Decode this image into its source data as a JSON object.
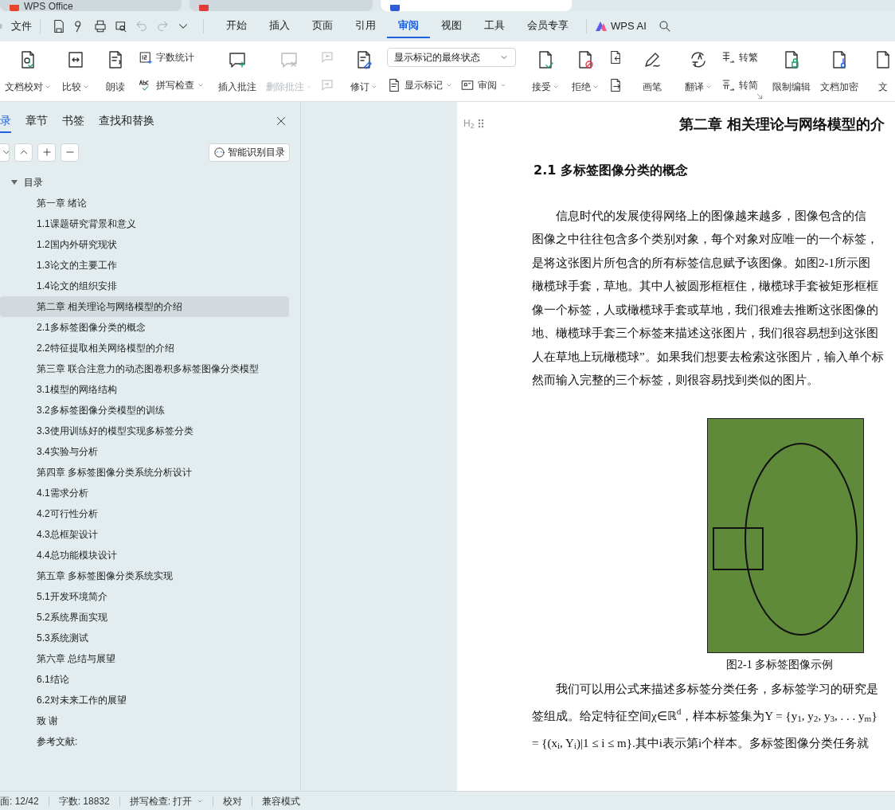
{
  "browser_tabs": [
    {
      "label": "WPS Office",
      "selected": false
    },
    {
      "selected": false
    },
    {
      "selected": true
    }
  ],
  "menu": {
    "file": "文件",
    "tabs": [
      {
        "label": "开始",
        "selected": false
      },
      {
        "label": "插入",
        "selected": false
      },
      {
        "label": "页面",
        "selected": false
      },
      {
        "label": "引用",
        "selected": false
      },
      {
        "label": "审阅",
        "selected": true
      },
      {
        "label": "视图",
        "selected": false
      },
      {
        "label": "工具",
        "selected": false
      },
      {
        "label": "会员专享",
        "selected": false
      }
    ],
    "ai": "WPS AI"
  },
  "ribbon": {
    "groups": [
      {
        "items": [
          {
            "kind": "large",
            "label": "文档校对",
            "dropdown": true,
            "disabled": false
          },
          {
            "kind": "large",
            "label": "比较",
            "dropdown": true,
            "disabled": false
          },
          {
            "kind": "large",
            "label": "朗读",
            "dropdown": false,
            "disabled": false
          },
          {
            "kind": "stack",
            "items": [
              {
                "kind": "small",
                "label": "字数统计",
                "dropdown": false,
                "disabled": false
              },
              {
                "kind": "small",
                "label": "拼写检查",
                "dropdown": true,
                "disabled": false
              }
            ]
          }
        ]
      },
      {
        "items": [
          {
            "kind": "large",
            "label": "插入批注",
            "dropdown": false,
            "disabled": false
          },
          {
            "kind": "large",
            "label": "删除批注",
            "dropdown": true,
            "disabled": true
          },
          {
            "kind": "stack",
            "items": [
              {
                "kind": "icon",
                "disabled": true
              },
              {
                "kind": "icon",
                "disabled": true
              }
            ]
          }
        ]
      },
      {
        "items": [
          {
            "kind": "large",
            "label": "修订",
            "dropdown": true,
            "disabled": false
          },
          {
            "kind": "stack",
            "items": [
              {
                "kind": "select",
                "label": "显示标记的最终状态"
              },
              {
                "kind": "pair",
                "items": [
                  {
                    "kind": "small",
                    "label": "显示标记",
                    "dropdown": true,
                    "disabled": false
                  },
                  {
                    "kind": "small",
                    "label": "审阅",
                    "dropdown": true,
                    "disabled": false
                  }
                ]
              }
            ]
          }
        ]
      },
      {
        "items": [
          {
            "kind": "large",
            "label": "接受",
            "dropdown": true,
            "disabled": false
          },
          {
            "kind": "large",
            "label": "拒绝",
            "dropdown": true,
            "disabled": false
          },
          {
            "kind": "stack",
            "items": [
              {
                "kind": "icon",
                "disabled": false
              },
              {
                "kind": "icon",
                "disabled": false
              }
            ]
          }
        ]
      },
      {
        "items": [
          {
            "kind": "large",
            "label": "画笔",
            "dropdown": false,
            "disabled": false
          }
        ]
      },
      {
        "items": [
          {
            "kind": "large",
            "label": "翻译",
            "dropdown": true,
            "disabled": false
          },
          {
            "kind": "stack",
            "items": [
              {
                "kind": "small",
                "label": "转繁",
                "dropdown": false,
                "disabled": false
              },
              {
                "kind": "small",
                "label": "转简",
                "dropdown": false,
                "disabled": false
              }
            ]
          }
        ]
      },
      {
        "items": [
          {
            "kind": "large",
            "label": "限制编辑",
            "dropdown": false,
            "disabled": false
          },
          {
            "kind": "large",
            "label": "文档加密",
            "dropdown": false,
            "disabled": false
          },
          {
            "kind": "large",
            "label": "文",
            "dropdown": false,
            "disabled": false
          }
        ]
      }
    ]
  },
  "sidebar": {
    "tabs": [
      {
        "label": "录",
        "selected": true
      },
      {
        "label": "章节",
        "selected": false
      },
      {
        "label": "书签",
        "selected": false
      },
      {
        "label": "查找和替换",
        "selected": false
      }
    ],
    "smart_toc_button": "智能识别目录",
    "toc": [
      {
        "label": "目录",
        "expanded": true,
        "selected": false,
        "children": [
          {
            "label": "第一章 绪论",
            "selected": false
          },
          {
            "label": "1.1课题研究背景和意义",
            "selected": false
          },
          {
            "label": "1.2国内外研究现状",
            "selected": false
          },
          {
            "label": "1.3论文的主要工作",
            "selected": false
          },
          {
            "label": "1.4论文的组织安排",
            "selected": false
          },
          {
            "label": "第二章 相关理论与网络模型的介绍",
            "selected": true
          },
          {
            "label": "2.1多标签图像分类的概念",
            "selected": false
          },
          {
            "label": "2.2特征提取相关网络模型的介绍",
            "selected": false
          },
          {
            "label": "第三章 联合注意力的动态图卷积多标签图像分类模型",
            "selected": false
          },
          {
            "label": "3.1模型的网络结构",
            "selected": false
          },
          {
            "label": "3.2多标签图像分类模型的训练",
            "selected": false
          },
          {
            "label": "3.3使用训练好的模型实现多标签分类",
            "selected": false
          },
          {
            "label": "3.4实验与分析",
            "selected": false
          },
          {
            "label": "第四章 多标签图像分类系统分析设计",
            "selected": false
          },
          {
            "label": "4.1需求分析",
            "selected": false
          },
          {
            "label": "4.2可行性分析",
            "selected": false
          },
          {
            "label": "4.3总框架设计",
            "selected": false
          },
          {
            "label": "4.4总功能模块设计",
            "selected": false
          },
          {
            "label": "第五章 多标签图像分类系统实现",
            "selected": false
          },
          {
            "label": "5.1开发环境简介",
            "selected": false
          },
          {
            "label": "5.2系统界面实现",
            "selected": false
          },
          {
            "label": "5.3系统测试",
            "selected": false
          },
          {
            "label": "第六章 总结与展望",
            "selected": false
          },
          {
            "label": "6.1结论",
            "selected": false
          },
          {
            "label": "6.2对未来工作的展望",
            "selected": false
          },
          {
            "label": "致 谢",
            "selected": false
          },
          {
            "label": "参考文献:",
            "selected": false
          }
        ]
      }
    ]
  },
  "document": {
    "heading_marker": "H$_{2}$",
    "chapter_title": "第二章 相关理论与网络模型的介",
    "section_title": "2.1  多标签图像分类的概念",
    "paragraph_1": [
      "信息时代的发展使得网络上的图像越来越多，图像包含的信",
      "图像之中往往包含多个类别对象，每个对象对应唯一的一个标签，",
      "是将这张图片所包含的所有标签信息赋予该图像。如图2-1所示图",
      "橄榄球手套，草地。其中人被圆形框框住，橄榄球手套被矩形框框",
      "像一个标签，人或橄榄球手套或草地，我们很难去推断这张图像的",
      "地、橄榄球手套三个标签来描述这张图片，我们很容易想到这张图",
      "人在草地上玩橄榄球”。如果我们想要去检索这张图片，输入单个标",
      "然而输入完整的三个标签，则很容易找到类似的图片。"
    ],
    "figure_caption": "图2-1 多标签图像示例",
    "paragraph_2": [
      "我们可以用公式来描述多标签分类任务，多标签学习的研究是",
      "签组成。给定特征空间χ∈ℝ$^{d}$，样本标签集为Y = {y$_{1}$, y$_{2}$, y$_{3}$, . . . y$_{m}$}",
      "= {(x$_{i}$, Y$_{i}$)|1 ≤ i ≤ m}.其中i表示第i个样本。多标签图像分类任务就"
    ]
  },
  "status_bar": [
    {
      "kind": "text",
      "label": "面: 12/42"
    },
    {
      "kind": "text",
      "label": "字数: 18832"
    },
    {
      "kind": "dropdown",
      "label": "拼写检查: 打开"
    },
    {
      "kind": "text",
      "label": "校对"
    },
    {
      "kind": "text",
      "label": "兼容模式"
    }
  ]
}
